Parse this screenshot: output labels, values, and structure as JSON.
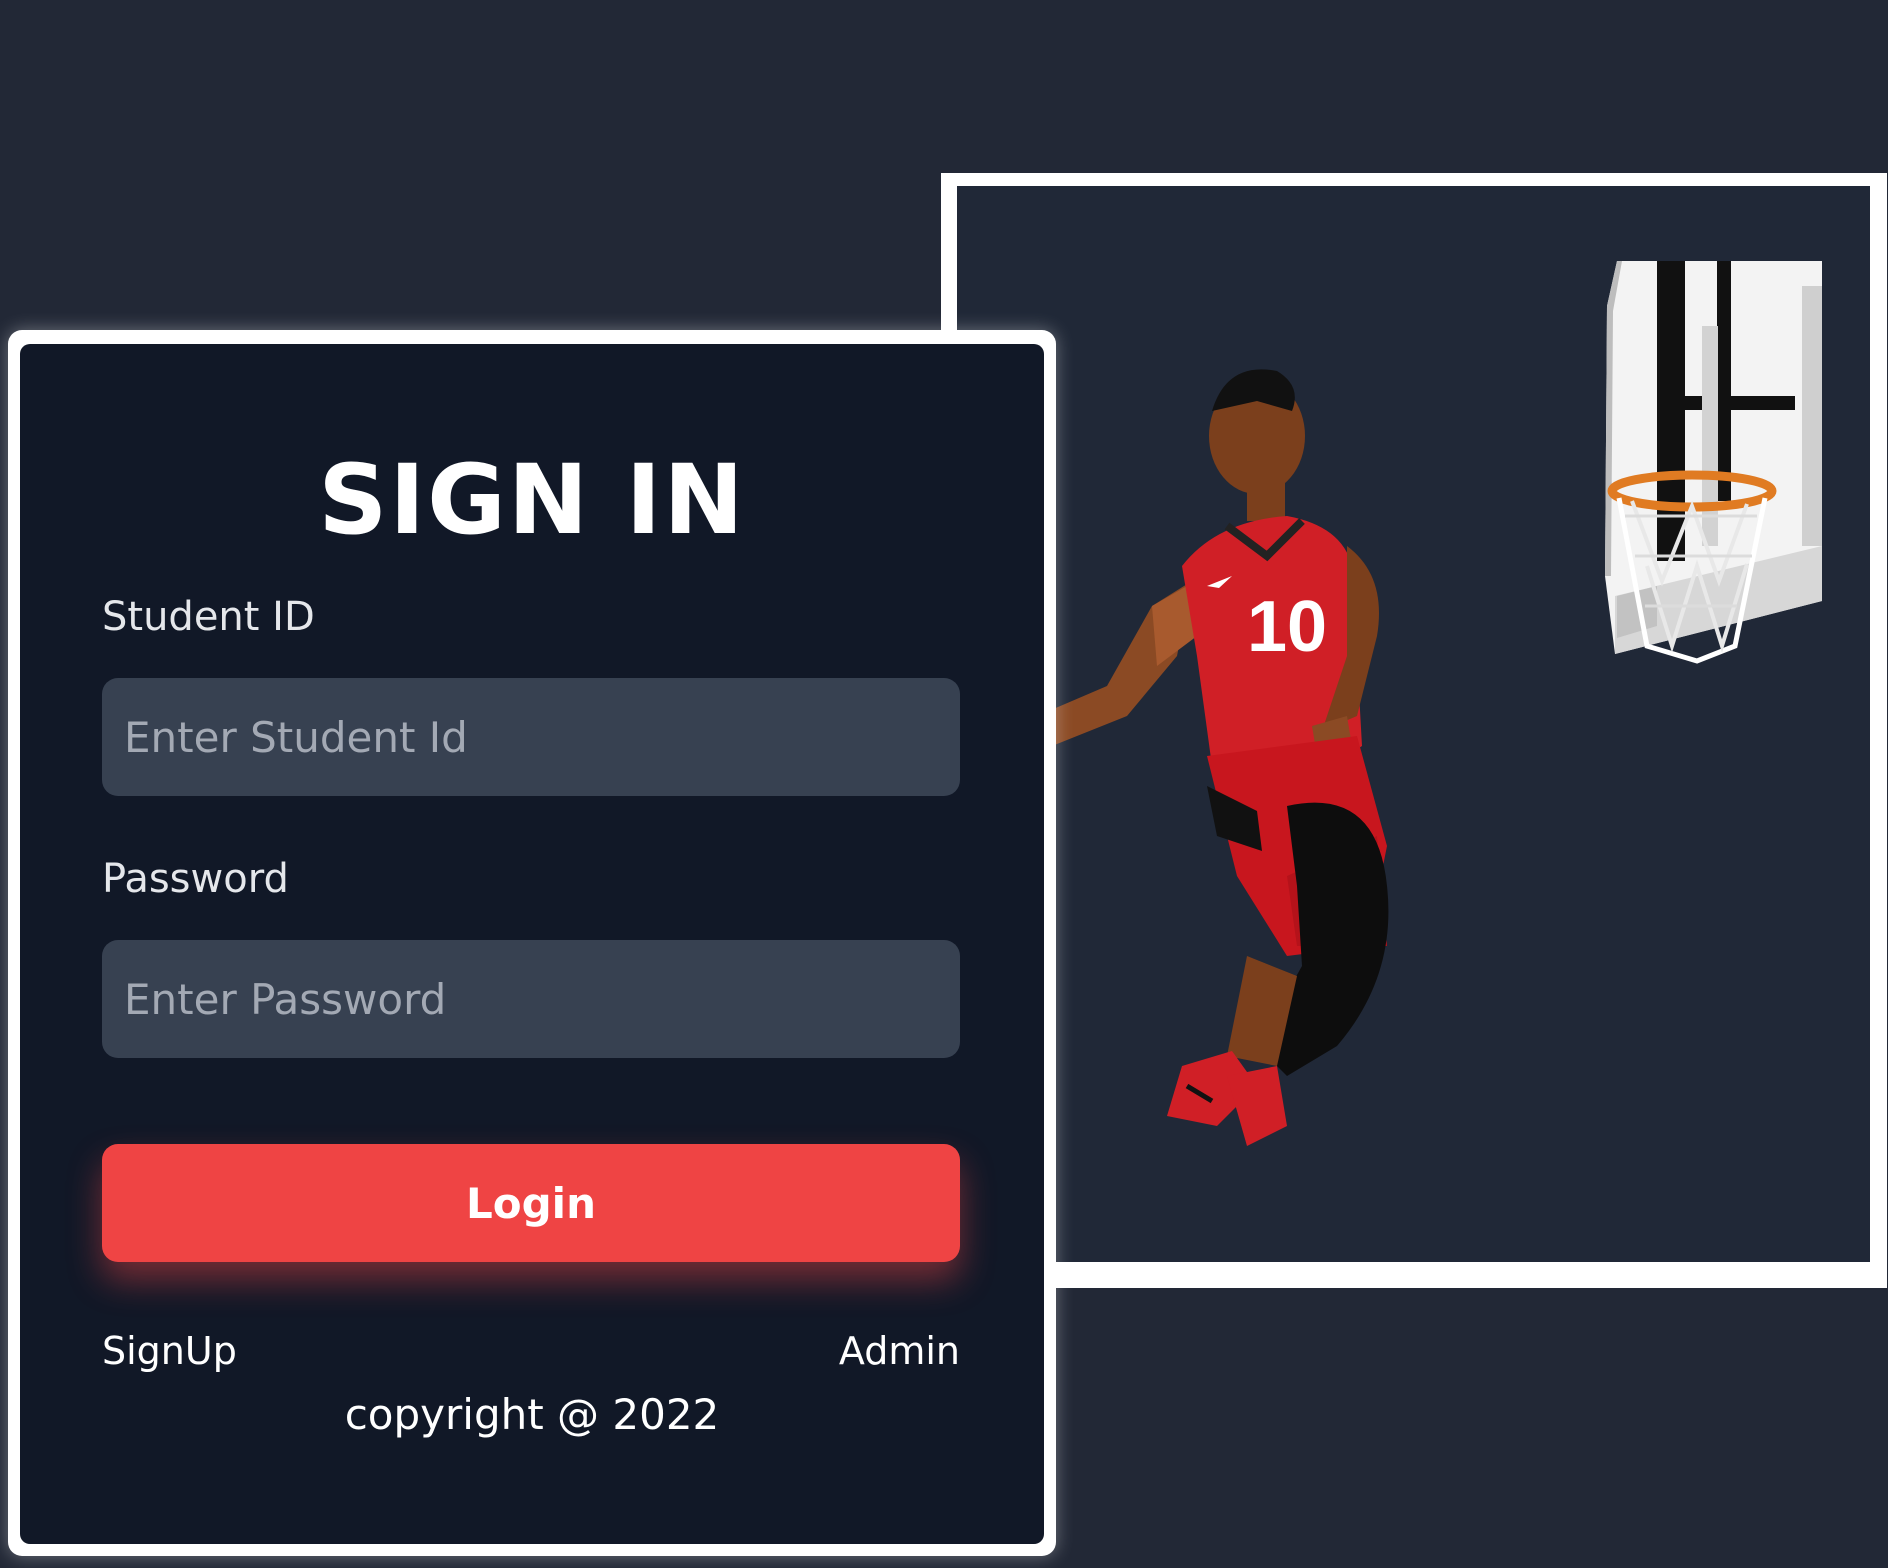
{
  "signin": {
    "title": "SIGN IN",
    "student_id_label": "Student ID",
    "student_id_placeholder": "Enter Student Id",
    "password_label": "Password",
    "password_placeholder": "Enter Password",
    "login_label": "Login",
    "signup_link": "SignUp",
    "admin_link": "Admin",
    "copyright": "copyright @ 2022"
  },
  "illustration": {
    "subject": "basketball-player-dunk-illustration",
    "jersey_number": "10"
  },
  "colors": {
    "page_bg": "#222836",
    "card_bg": "#111827",
    "input_bg": "#374151",
    "accent": "#ef4444",
    "frame": "#ffffff"
  }
}
